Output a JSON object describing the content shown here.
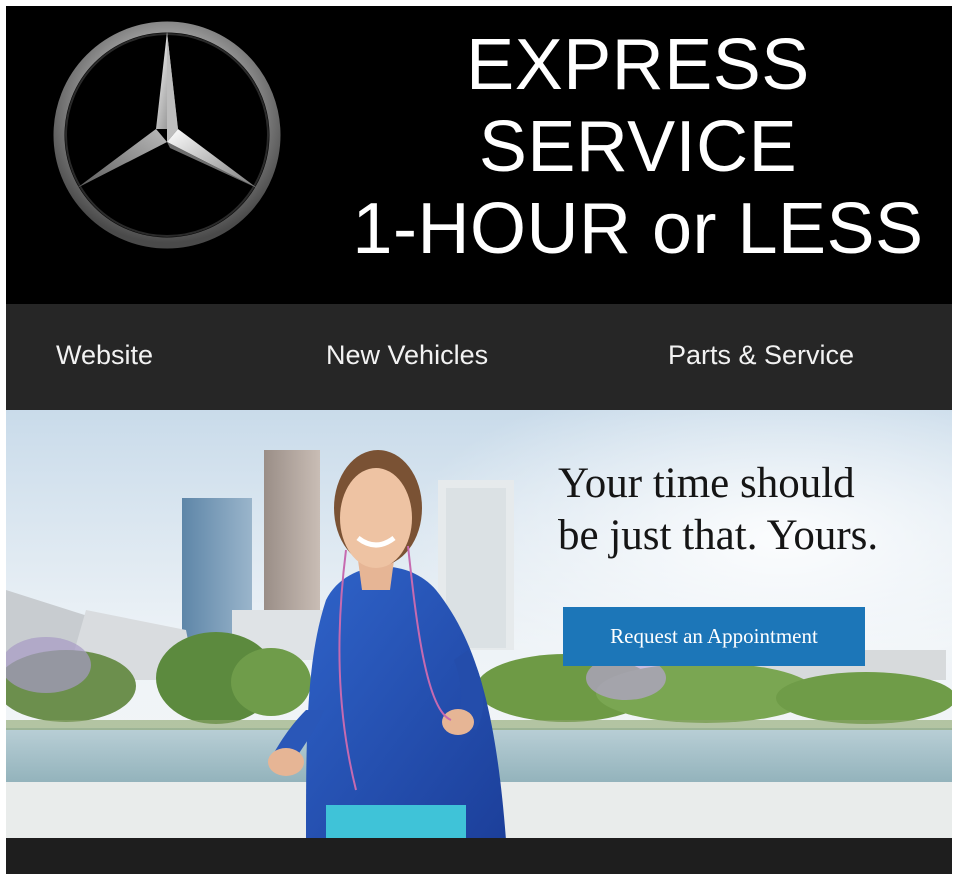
{
  "header": {
    "logo_name": "mercedes-star-logo",
    "headline_lines": [
      "EXPRESS",
      "SERVICE",
      "1-HOUR or LESS"
    ]
  },
  "nav": {
    "items": [
      {
        "label": "Website"
      },
      {
        "label": "New Vehicles"
      },
      {
        "label": "Parts & Service"
      }
    ]
  },
  "hero": {
    "tagline_lines": [
      "Your time should",
      "be just that. Yours."
    ],
    "cta_label": "Request an Appointment",
    "image_description_name": "woman-jogging-city-park-photo"
  },
  "colors": {
    "header_bg": "#000000",
    "nav_bg": "#262626",
    "cta_bg": "#1c76b8",
    "footer_bg": "#1e1e1e"
  }
}
